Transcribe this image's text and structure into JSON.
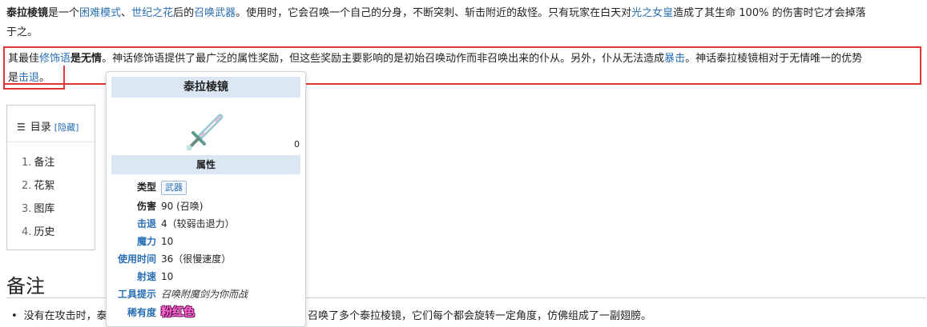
{
  "para1": {
    "item_bold": "泰拉棱镜",
    "t1": "是一个",
    "link_mode": "困难模式",
    "t2": "、",
    "link_flower": "世纪之花",
    "t3": "后的",
    "link_summon": "召唤武器",
    "t4": "。使用时，它会召唤一个自己的分身，不断突刺、斩击附近的敌怪。只有玩家在白天对",
    "link_empress": "光之女皇",
    "t5": "造成了其生命 100% 的伤害时它才会掉落",
    "t6": "于之。"
  },
  "para2": {
    "t1": "其最佳",
    "link_modifier": "修饰语",
    "t2": "是",
    "best": "无情",
    "t3": "。神话修饰语提供了最广泛的属性奖励，但这些奖励主要影响的是初始召唤动作而非召唤出来的仆从。另外，仆从无法造成",
    "link_crit": "暴击",
    "t4": "。神话泰拉棱镜相对于无情唯一的优势",
    "t5": "是",
    "link_kb": "击退",
    "t6": "。"
  },
  "toc": {
    "title": "目录",
    "hide_label": "[隐藏]",
    "items": [
      {
        "num": "1.",
        "label": "备注"
      },
      {
        "num": "2.",
        "label": "花絮"
      },
      {
        "num": "3.",
        "label": "图库"
      },
      {
        "num": "4.",
        "label": "历史"
      }
    ]
  },
  "section": {
    "heading": "备注",
    "bullet_start": "没有在攻击时，泰",
    "bullet_end": "召唤了多个泰拉棱镜，它们每个都会旋转一定角度，仿佛组成了一副翅膀。"
  },
  "card": {
    "title": "泰拉棱镜",
    "side_mark": "0",
    "attributes_header": "属性",
    "rows": {
      "type_key": "类型",
      "type_val": "武器",
      "damage_key": "伤害",
      "damage_val": "90 (召唤)",
      "knockback_key": "击退",
      "knockback_val": "4（较弱击退力）",
      "mana_key": "魔力",
      "mana_val": "10",
      "usetime_key": "使用时间",
      "usetime_val": "36（很慢速度）",
      "velocity_key": "射速",
      "velocity_val": "10",
      "tooltip_key": "工具提示",
      "tooltip_val": "召唤附魔剑为你而战",
      "rarity_key": "稀有度",
      "rarity_val": "粉红色"
    }
  },
  "colors": {
    "link": "#2a6fb5",
    "highlight_border": "#e03535",
    "header_bg": "#dbe8f4",
    "rarity_pink": "#ff6ad5"
  }
}
